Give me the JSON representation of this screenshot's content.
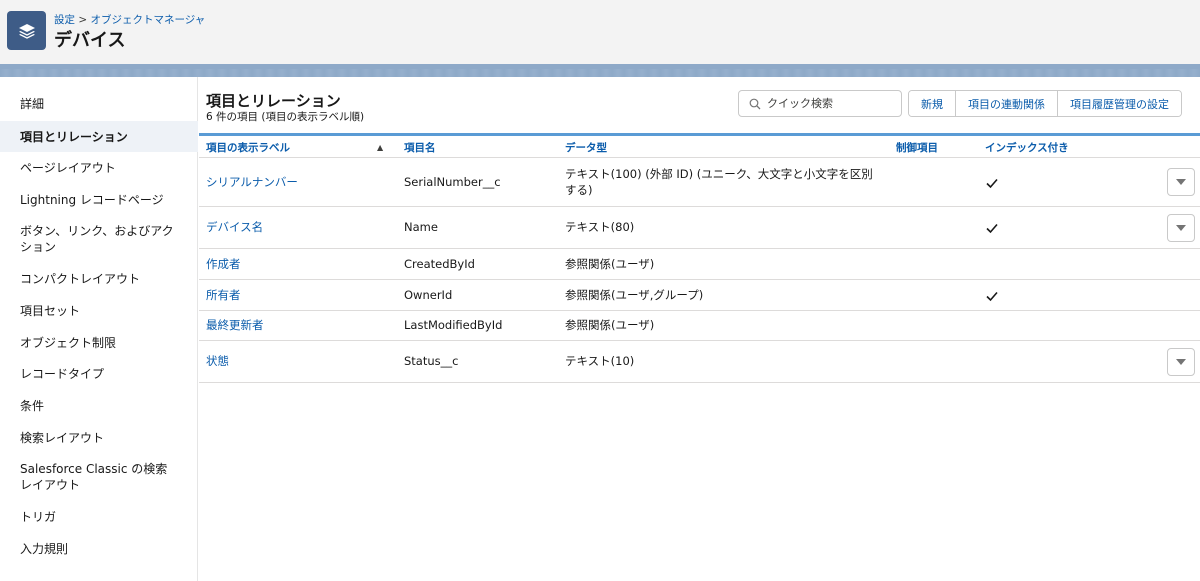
{
  "header": {
    "breadcrumb": [
      "設定",
      "オブジェクトマネージャ"
    ],
    "breadcrumb_sep": ">",
    "title": "デバイス",
    "icon": "layers-icon"
  },
  "sidebar": {
    "items": [
      {
        "label": "詳細"
      },
      {
        "label": "項目とリレーション",
        "active": true
      },
      {
        "label": "ページレイアウト"
      },
      {
        "label": "Lightning レコードページ"
      },
      {
        "label": "ボタン、リンク、およびアクション"
      },
      {
        "label": "コンパクトレイアウト"
      },
      {
        "label": "項目セット"
      },
      {
        "label": "オブジェクト制限"
      },
      {
        "label": "レコードタイプ"
      },
      {
        "label": "条件"
      },
      {
        "label": "検索レイアウト"
      },
      {
        "label": "Salesforce Classic の検索レイアウト"
      },
      {
        "label": "トリガ"
      },
      {
        "label": "入力規則"
      }
    ]
  },
  "main": {
    "title": "項目とリレーション",
    "subtitle": "6 件の項目 (項目の表示ラベル順)",
    "search_placeholder": "クイック検索",
    "buttons": [
      "新規",
      "項目の連動関係",
      "項目履歴管理の設定"
    ],
    "columns": [
      "項目の表示ラベル",
      "項目名",
      "データ型",
      "制御項目",
      "インデックス付き"
    ],
    "sort_indicator": "▲",
    "rows": [
      {
        "label": "シリアルナンバー",
        "name": "SerialNumber__c",
        "type": "テキスト(100) (外部 ID) (ユニーク、大文字と小文字を区別する)",
        "controlling": "",
        "indexed": true,
        "menu": true
      },
      {
        "label": "デバイス名",
        "name": "Name",
        "type": "テキスト(80)",
        "controlling": "",
        "indexed": true,
        "menu": true
      },
      {
        "label": "作成者",
        "name": "CreatedById",
        "type": "参照関係(ユーザ)",
        "controlling": "",
        "indexed": false,
        "menu": false
      },
      {
        "label": "所有者",
        "name": "OwnerId",
        "type": "参照関係(ユーザ,グループ)",
        "controlling": "",
        "indexed": true,
        "menu": false
      },
      {
        "label": "最終更新者",
        "name": "LastModifiedById",
        "type": "参照関係(ユーザ)",
        "controlling": "",
        "indexed": false,
        "menu": false
      },
      {
        "label": "状態",
        "name": "Status__c",
        "type": "テキスト(10)",
        "controlling": "",
        "indexed": false,
        "menu": true
      }
    ]
  },
  "colors": {
    "link": "#0b5cab",
    "header_icon_bg": "#3e5c87",
    "band": "#8ea9c8",
    "table_accent": "#5a9bd5"
  }
}
